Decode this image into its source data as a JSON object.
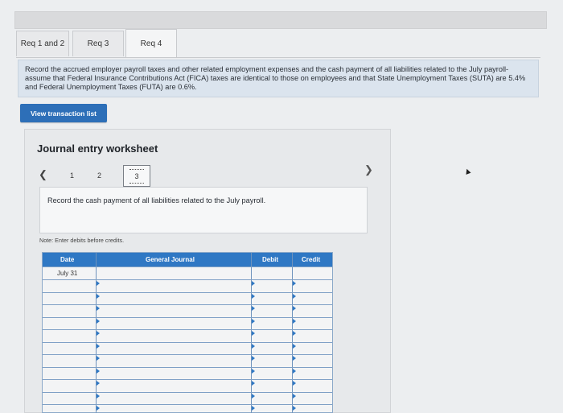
{
  "tabs": [
    {
      "label": "Req 1 and 2"
    },
    {
      "label": "Req 3"
    },
    {
      "label": "Req 4"
    }
  ],
  "instructions": "Record the accrued employer payroll taxes and other related employment expenses and the cash payment of all liabilities related to the July payroll-assume that Federal Insurance Contributions Act (FICA) taxes are identical to those on employees and that State Unemployment Taxes (SUTA) are 5.4% and Federal Unemployment Taxes (FUTA) are 0.6%.",
  "view_button": "View transaction list",
  "worksheet": {
    "title": "Journal entry worksheet",
    "prev_icon": "chevron-left-icon",
    "next_icon": "chevron-right-icon",
    "pages": [
      "1",
      "2",
      "3"
    ],
    "entry_prompt": "Record the cash payment of all liabilities related to the July payroll.",
    "note": "Note: Enter debits before credits."
  },
  "journal": {
    "headers": {
      "date": "Date",
      "account": "General Journal",
      "debit": "Debit",
      "credit": "Credit"
    },
    "date_value": "July 31"
  },
  "colors": {
    "accent": "#2f78c4",
    "button": "#2d6fb8",
    "instruction_bg": "#dbe4ee"
  }
}
